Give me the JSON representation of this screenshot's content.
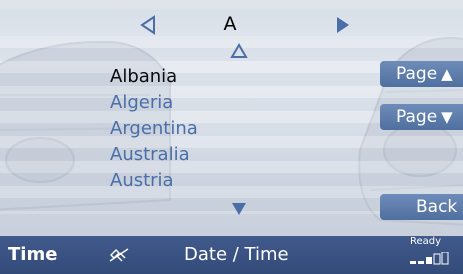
{
  "navigation": {
    "current_letter": "A",
    "prev_letter_icon": "triangle-left-icon",
    "next_letter_icon": "triangle-right-filled-icon",
    "scroll_up_icon": "triangle-up-outline-icon",
    "scroll_down_icon": "triangle-down-filled-icon"
  },
  "countries": [
    {
      "label": "Albania",
      "selected": true
    },
    {
      "label": "Algeria",
      "selected": false
    },
    {
      "label": "Argentina",
      "selected": false
    },
    {
      "label": "Australia",
      "selected": false
    },
    {
      "label": "Austria",
      "selected": false
    }
  ],
  "softkeys": {
    "page_up_label": "Page",
    "page_down_label": "Page",
    "back_label": "Back"
  },
  "statusbar": {
    "time_label": "Time",
    "satellite_icon": "satellite-off-icon",
    "datetime_label": "Date / Time",
    "ready_label": "Ready",
    "signal_icon": "signal-strength-icon"
  },
  "colors": {
    "accent": "#4a6fa8",
    "softkey": "#5a7aab",
    "statusbar": "#3a5282",
    "selected_text": "#0a0a0a"
  }
}
